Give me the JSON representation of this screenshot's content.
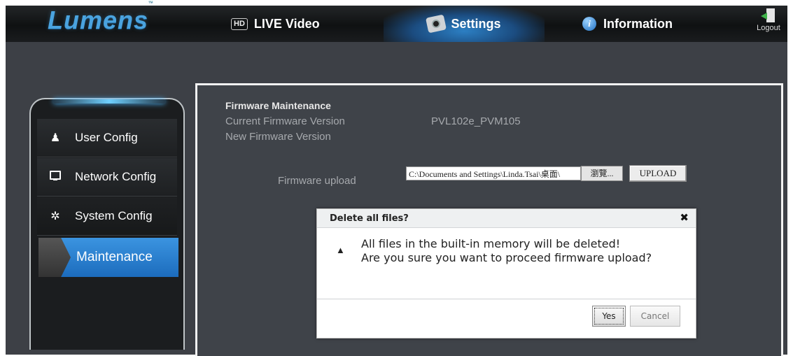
{
  "header": {
    "logo": "Lumens",
    "logo_tm": "™",
    "nav": {
      "live_video": {
        "badge": "HD",
        "label": "LIVE Video"
      },
      "settings": {
        "label": "Settings"
      },
      "information": {
        "icon_glyph": "i",
        "label": "Information"
      }
    },
    "logout_label": "Logout"
  },
  "sidebar": {
    "items": [
      {
        "label": "User Config",
        "icon": "user-icon",
        "glyph": "👤"
      },
      {
        "label": "Network Config",
        "icon": "monitor-icon"
      },
      {
        "label": "System Config",
        "icon": "gear-icon",
        "glyph": "✲"
      },
      {
        "label": "Maintenance",
        "active": true
      }
    ]
  },
  "firmware": {
    "title": "Firmware Maintenance",
    "current_label": "Current Firmware Version",
    "current_value": "PVL102e_PVM105",
    "new_label": "New Firmware Version",
    "upload_label": "Firmware upload",
    "file_path": "C:\\Documents and Settings\\Linda.Tsai\\桌面\\",
    "browse_label": "瀏覽...",
    "upload_button": "UPLOAD"
  },
  "dialog": {
    "title": "Delete all files?",
    "close_glyph": "✖",
    "warning_glyph": "▲",
    "message_line1": "All files in the built-in memory will be deleted!",
    "message_line2": "Are you sure you want to proceed firmware upload?",
    "yes_label": "Yes",
    "cancel_label": "Cancel"
  },
  "colors": {
    "accent": "#2f84d4",
    "logo": "#4aa3df",
    "background": "#3d4046"
  }
}
